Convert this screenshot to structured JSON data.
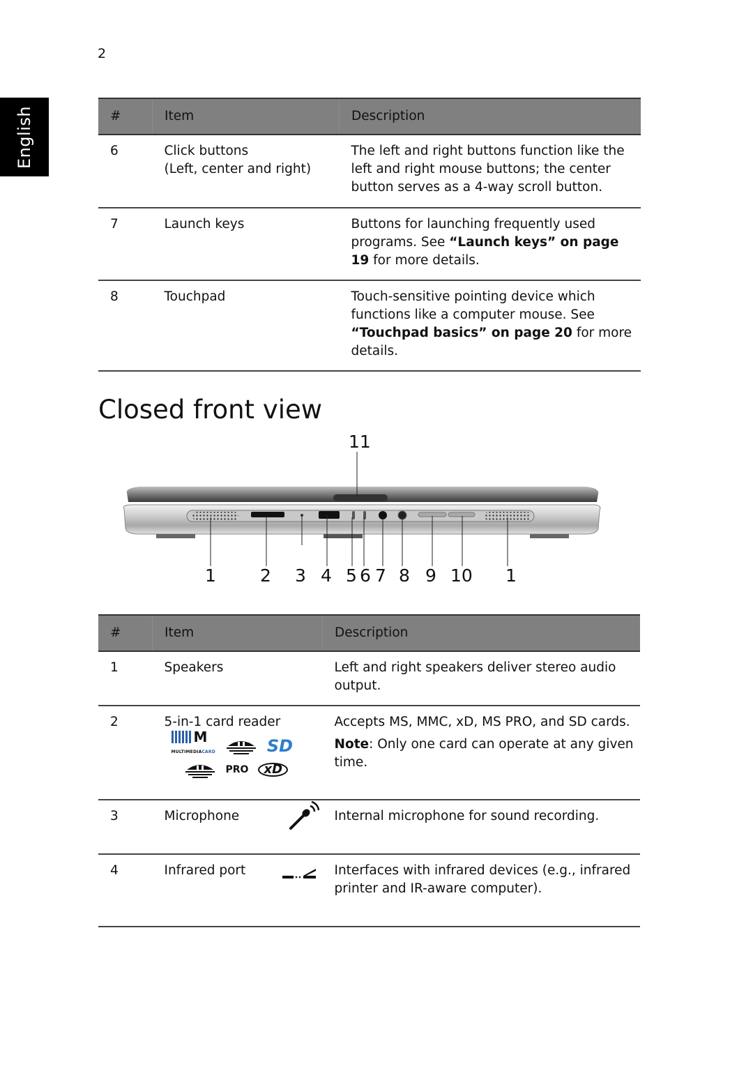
{
  "page": {
    "number": "2",
    "language_tab": "English",
    "section_heading": "Closed front view"
  },
  "table_top": {
    "headers": [
      "#",
      "Item",
      "Description"
    ],
    "rows": [
      {
        "num": "6",
        "item_line1": "Click buttons",
        "item_line2": "(Left, center and right)",
        "description": "The left and right buttons function like the left and right mouse buttons; the center button serves as a 4-way scroll button."
      },
      {
        "num": "7",
        "item_line1": "Launch keys",
        "desc_pre": "Buttons for launching frequently used programs. See ",
        "desc_link": "“Launch keys” on page 19",
        "desc_post": " for more details."
      },
      {
        "num": "8",
        "item_line1": "Touchpad",
        "desc_pre": "Touch-sensitive pointing device which functions like a computer mouse. See ",
        "desc_link": "“Touchpad basics” on page 20",
        "desc_post": " for more details."
      }
    ]
  },
  "figure": {
    "description": "Closed front view of notebook with numbered callouts",
    "callouts_bottom": [
      "1",
      "2",
      "3",
      "4",
      "5",
      "6",
      "7",
      "8",
      "9",
      "10",
      "1"
    ],
    "callout_top": "11"
  },
  "table_bottom": {
    "headers": [
      "#",
      "Item",
      "Description"
    ],
    "rows": [
      {
        "num": "1",
        "item": "Speakers",
        "description": "Left and right speakers deliver stereo audio output."
      },
      {
        "num": "2",
        "item": "5-in-1 card reader",
        "logos": {
          "mmc_big": "M",
          "mmc_text_a": "MULTIMEDIA",
          "mmc_text_b": "CARD",
          "sd": "SD",
          "pro": "PRO",
          "xd": "xD"
        },
        "description": "Accepts MS, MMC, xD, MS PRO, and SD cards.",
        "note_label": "Note",
        "note_text": ": Only one card can operate at any given time."
      },
      {
        "num": "3",
        "item": "Microphone",
        "icon": "microphone-icon",
        "description": "Internal microphone for sound recording."
      },
      {
        "num": "4",
        "item": "Infrared port",
        "icon": "infrared-icon",
        "description": "Interfaces with infrared devices (e.g., infrared printer and IR-aware computer)."
      }
    ]
  }
}
